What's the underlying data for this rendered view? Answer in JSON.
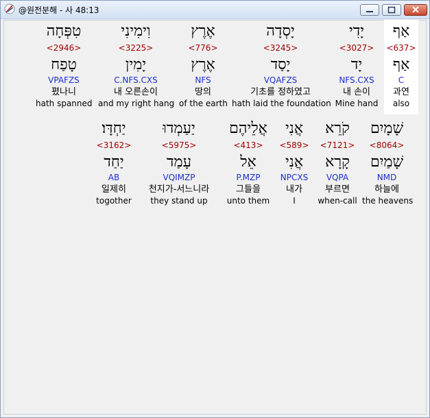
{
  "window": {
    "title": "@원전분해 - 사 48:13"
  },
  "rows": [
    [
      {
        "heb": "אַף",
        "num": "<637>",
        "lex": "אַף",
        "morph": "C",
        "kor": "과연",
        "eng": "also"
      },
      {
        "heb": "יָדִי",
        "num": "<3027>",
        "lex": "יָד",
        "morph": "NFS.CXS",
        "kor": "내 손이",
        "eng": "Mine hand"
      },
      {
        "heb": "יָסְדָה",
        "num": "<3245>",
        "lex": "יָסַד",
        "morph": "VQAFZS",
        "kor": "기초를 정하였고",
        "eng": "hath laid the foundation"
      },
      {
        "heb": "אֶרֶץ",
        "num": "<776>",
        "lex": "אֶרֶץ",
        "morph": "NFS",
        "kor": "땅의",
        "eng": "of the earth"
      },
      {
        "heb": "וִימִינִי",
        "num": "<3225>",
        "lex": "יָמִין",
        "morph": "C.NFS.CXS",
        "kor": "내 오른손이",
        "eng": "and my right hang"
      },
      {
        "heb": "טִפְּחָה",
        "num": "<2946>",
        "lex": "טָפַח",
        "morph": "VPAFZS",
        "kor": "폈나니",
        "eng": "hath spanned"
      }
    ],
    [
      {
        "heb": "שָׁמָיִם",
        "num": "<8064>",
        "lex": "שָׁמַיִם",
        "morph": "NMD",
        "kor": "하늘에",
        "eng": "the heavens"
      },
      {
        "heb": "קֹרֵא",
        "num": "<7121>",
        "lex": "קָרָא",
        "morph": "VQPA",
        "kor": "부르면",
        "eng": "when-call"
      },
      {
        "heb": "אֲנִי",
        "num": "<589>",
        "lex": "אֲנִי",
        "morph": "NPCXS",
        "kor": "내가",
        "eng": "I"
      },
      {
        "heb": "אֲלֵיהֶם",
        "num": "<413>",
        "lex": "אֵל",
        "morph": "P.MZP",
        "kor": "그들을",
        "eng": "unto them"
      },
      {
        "heb": "יַעַמְדוּ",
        "num": "<5975>",
        "lex": "עָמַד",
        "morph": "VQIMZP",
        "kor": "천지가-서느니라",
        "eng": "they stand up"
      },
      {
        "heb": "יַחְדָּו׃",
        "num": "<3162>",
        "lex": "יַחַד",
        "morph": "AB",
        "kor": "일제히",
        "eng": "togother"
      }
    ]
  ]
}
